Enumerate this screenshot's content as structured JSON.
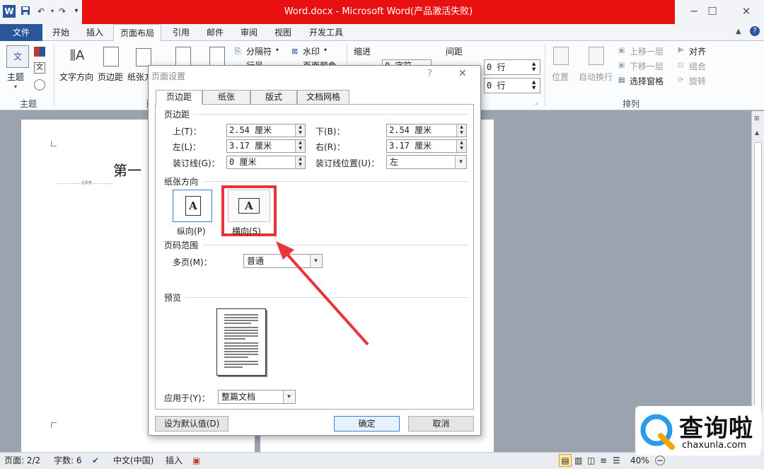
{
  "title_bar": {
    "title": "Word.docx - Microsoft Word(产品激活失败)",
    "quick_access": {
      "save_icon": "save-icon",
      "undo_icon": "undo-icon",
      "redo_icon": "redo-icon"
    },
    "minimize": "─",
    "maximize": "☐",
    "close": "✕"
  },
  "tabs": [
    {
      "label": "文件"
    },
    {
      "label": "开始"
    },
    {
      "label": "插入"
    },
    {
      "label": "页面布局"
    },
    {
      "label": "引用"
    },
    {
      "label": "邮件"
    },
    {
      "label": "审阅"
    },
    {
      "label": "视图"
    },
    {
      "label": "开发工具"
    }
  ],
  "ribbon": {
    "theme_group": {
      "theme_label": "主题",
      "group_label": "主题"
    },
    "page_setup": {
      "text_direction": "文字方向",
      "margins": "页边距",
      "paper_partial": "纸张方",
      "page_partial": "页",
      "breaks": "分隔符",
      "line_numbers": "行号",
      "watermark": "水印",
      "page_color": "页面颜色",
      "indent": "缩进",
      "indent_value_partial": "0 字符",
      "spacing": "间距",
      "spacing_before": "0 行",
      "spacing_after": "0 行"
    },
    "arrange": {
      "position": "位置",
      "wrap": "自动换行",
      "bring_forward": "上移一层",
      "send_backward": "下移一层",
      "selection_pane": "选择窗格",
      "align": "对齐",
      "group": "组合",
      "rotate": "旋转",
      "group_label": "排列"
    }
  },
  "document": {
    "heading_partial": "第一",
    "small_text": "…………………分页符………………"
  },
  "dialog": {
    "title": "页面设置",
    "help": "?",
    "close": "✕",
    "tabs": [
      "页边距",
      "纸张",
      "版式",
      "文档网格"
    ],
    "margins_section": "页边距",
    "top_label": "上(T)：",
    "top_value": "2.54 厘米",
    "bottom_label": "下(B)：",
    "bottom_value": "2.54 厘米",
    "left_label": "左(L)：",
    "left_value": "3.17 厘米",
    "right_label": "右(R)：",
    "right_value": "3.17 厘米",
    "gutter_label": "装订线(G)：",
    "gutter_value": "0 厘米",
    "gutter_pos_label": "装订线位置(U)：",
    "gutter_pos_value": "左",
    "orientation_section": "纸张方向",
    "portrait_label": "纵向(P)",
    "landscape_label": "横向(S)",
    "pages_section": "页码范围",
    "multiple_pages_label": "多页(M)：",
    "multiple_pages_value": "普通",
    "preview_section": "预览",
    "apply_to_label": "应用于(Y)：",
    "apply_to_value": "整篇文档",
    "default_button": "设为默认值(D)",
    "ok_button": "确定",
    "cancel_button": "取消"
  },
  "status_bar": {
    "page": "页面: 2/2",
    "words": "字数: 6",
    "language": "中文(中国)",
    "insert_mode": "插入",
    "zoom": "40%"
  },
  "watermark": {
    "brand": "查询啦",
    "url": "chaxunla.com"
  },
  "colors": {
    "title_red": "#e81010",
    "word_blue": "#2b579a",
    "highlight_red": "#e8343a"
  }
}
